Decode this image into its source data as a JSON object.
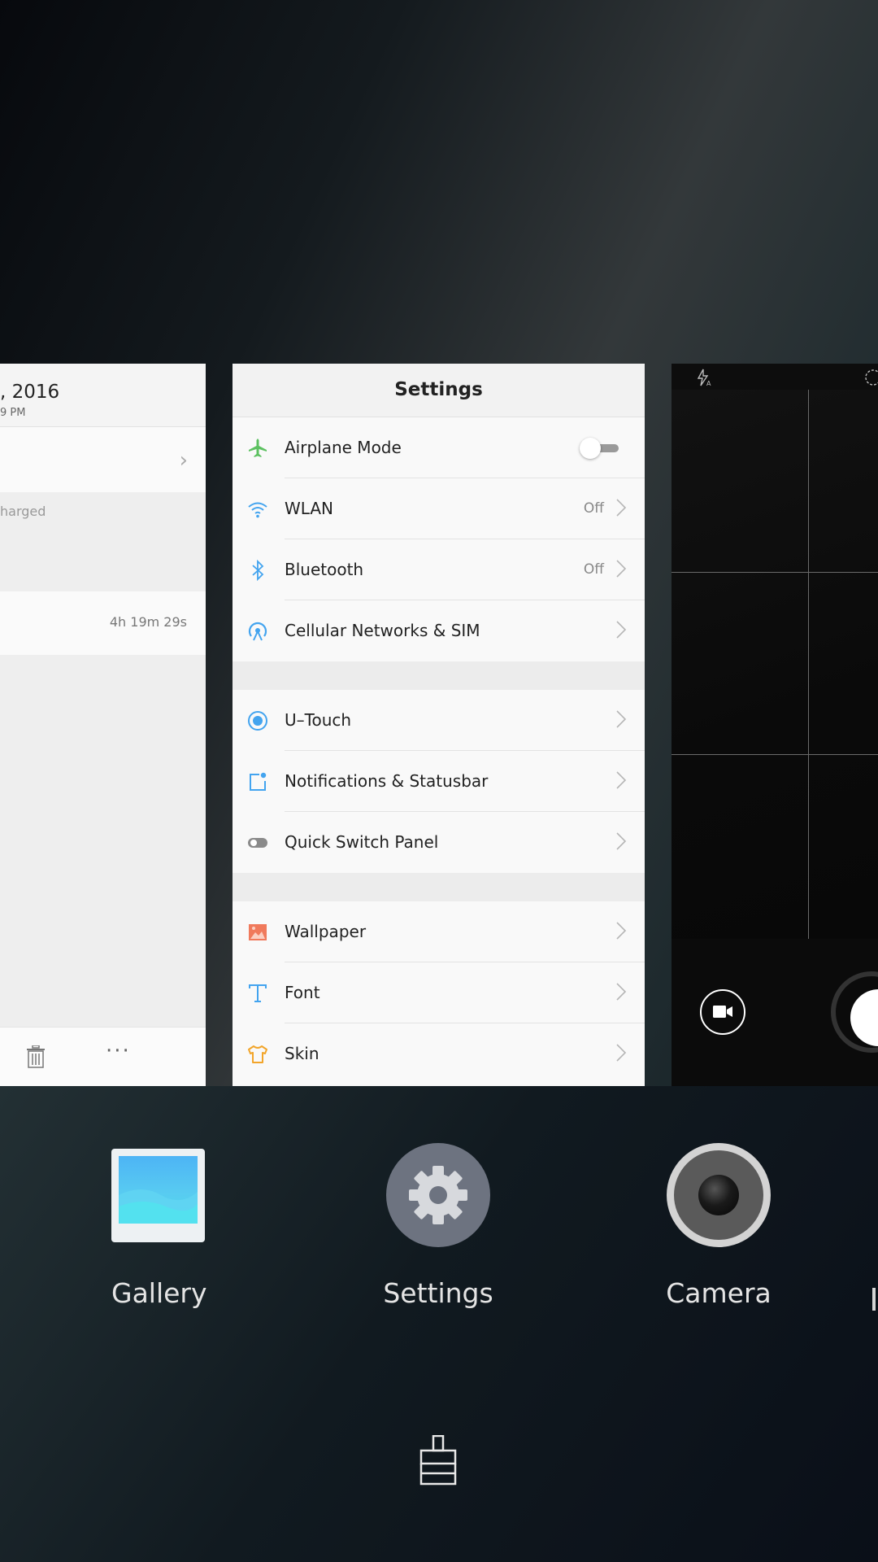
{
  "left_card": {
    "date": ", 2016",
    "time": "9 PM",
    "charged_text": "harged",
    "duration": "4h 19m 29s",
    "more_label": "···"
  },
  "settings_card": {
    "title": "Settings",
    "items": [
      {
        "label": "Airplane Mode",
        "icon": "airplane-icon",
        "toggle_on": false
      },
      {
        "label": "WLAN",
        "icon": "wifi-icon",
        "value": "Off"
      },
      {
        "label": "Bluetooth",
        "icon": "bluetooth-icon",
        "value": "Off"
      },
      {
        "label": "Cellular Networks & SIM",
        "icon": "cellular-icon"
      },
      {
        "label": "U–Touch",
        "icon": "u-touch-icon"
      },
      {
        "label": "Notifications & Statusbar",
        "icon": "notification-icon"
      },
      {
        "label": "Quick Switch Panel",
        "icon": "quick-switch-icon"
      },
      {
        "label": "Wallpaper",
        "icon": "wallpaper-icon"
      },
      {
        "label": "Font",
        "icon": "font-icon"
      },
      {
        "label": "Skin",
        "icon": "skin-icon"
      }
    ]
  },
  "apps": [
    {
      "label": "Gallery",
      "icon": "gallery-icon"
    },
    {
      "label": "Settings",
      "icon": "settings-gear-icon"
    },
    {
      "label": "Camera",
      "icon": "camera-icon"
    }
  ],
  "colors": {
    "airplane": "#5cc160",
    "blue_icon": "#43a4ef",
    "wallpaper": "#f07a5c",
    "skin": "#f2a52a",
    "toggle_icon": "#8a8a8a"
  }
}
